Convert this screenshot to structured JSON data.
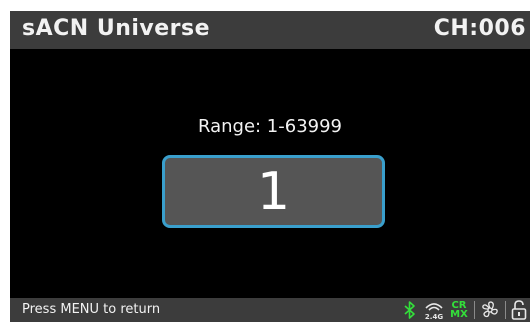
{
  "header": {
    "title": "sACN Universe",
    "channel": "CH:006"
  },
  "main": {
    "range_label": "Range: 1-63999",
    "value": "1"
  },
  "footer": {
    "hint": "Press MENU to return",
    "status_icons": {
      "bluetooth": {
        "icon": "bluetooth-icon",
        "color": "#33e03a"
      },
      "wireless": {
        "icon": "wireless-2.4g-icon",
        "label": "2.4G"
      },
      "crmx": {
        "icon": "crmx-icon",
        "label_top": "CR",
        "label_bottom": "MX",
        "color": "#33e03a"
      },
      "fan": {
        "icon": "fan-icon"
      },
      "lock": {
        "icon": "unlock-icon"
      }
    }
  },
  "colors": {
    "header_bg": "#3c3c3c",
    "screen_bg": "#000000",
    "value_border": "#3a9fcc",
    "value_bg": "#555555",
    "accent_green": "#33e03a"
  }
}
